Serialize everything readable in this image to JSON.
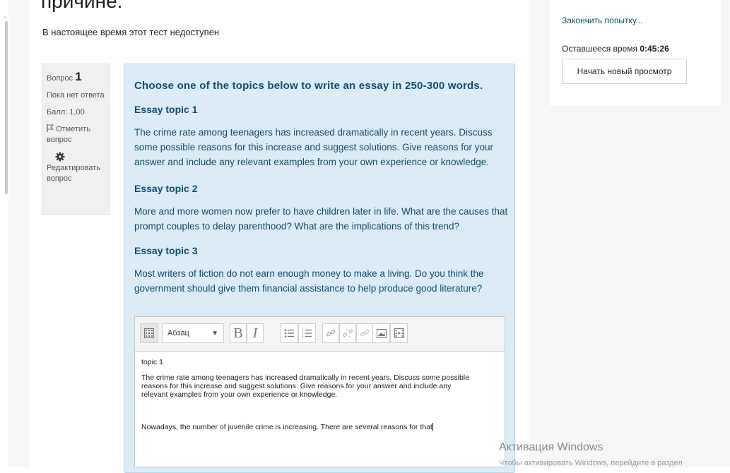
{
  "page": {
    "title_fragment": "причине.",
    "notice": "В настоящее время этот тест недоступен"
  },
  "question_info": {
    "label": "Вопрос",
    "number": "1",
    "status": "Пока нет ответа",
    "score": "Балл: 1,00",
    "flag_label": "Отметить вопрос",
    "edit_label": "Редактировать вопрос"
  },
  "question": {
    "heading": "Choose one of the topics below to write an essay in 250-300 words.",
    "topics": [
      {
        "title": "Essay topic 1",
        "lines": [
          "The crime rate among teenagers has increased dramatically in recent years.  Discuss",
          "some possible reasons for this increase and suggest solutions. Give reasons for your",
          "answer and include any relevant examples from your own experience or knowledge."
        ]
      },
      {
        "title": "Essay topic 2",
        "lines": [
          "More and more women now prefer to have children later in life. What are the causes that",
          "prompt couples to delay parenthood? What are the implications of this trend?"
        ]
      },
      {
        "title": "Essay topic 3",
        "lines": [
          "Most writers of fiction do not earn enough money to make a living. Do you think the",
          "government should give them financial assistance to help produce good literature?"
        ]
      }
    ]
  },
  "editor": {
    "format_select": "Абзац",
    "bold": "B",
    "italic": "I",
    "content": {
      "line1": "topic 1",
      "para": [
        "The crime rate among teenagers has increased dramatically in recent years.  Discuss some possible",
        "reasons for this increase and suggest solutions. Give reasons for your answer and include any",
        "relevant examples from your own experience or knowledge."
      ],
      "typed": "Nowadays, the number of juvenile crime is increasing. There are several reasons for that"
    }
  },
  "sidebar": {
    "finish_link": "Закончить попытку...",
    "time_label": "Оставшееся время",
    "time_value": "0:45:26",
    "new_view_button": "Начать новый просмотр"
  },
  "windows_activation": {
    "title": "Активация Windows",
    "subtitle": "Чтобы активировать Windows, перейдите в раздел"
  },
  "colors": {
    "question_bg": "#dcecf6",
    "question_text": "#0f4c6e",
    "page_bg": "#f6f6f6"
  }
}
